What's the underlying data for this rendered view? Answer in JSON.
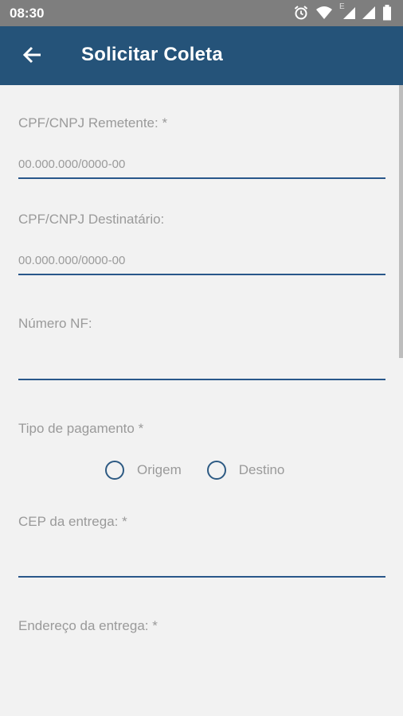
{
  "status_bar": {
    "time": "08:30",
    "icons": [
      "alarm-icon",
      "wifi-icon",
      "signal-e-icon",
      "signal-icon",
      "battery-icon"
    ],
    "network_label": "E"
  },
  "app_bar": {
    "title": "Solicitar Coleta",
    "back_icon": "arrow-left-icon",
    "color": "#255379"
  },
  "form": {
    "cpf_remetente": {
      "label": "CPF/CNPJ Remetente: *",
      "placeholder": "00.000.000/0000-00",
      "value": ""
    },
    "cpf_destinatario": {
      "label": "CPF/CNPJ Destinatário:",
      "placeholder": "00.000.000/0000-00",
      "value": ""
    },
    "numero_nf": {
      "label": "Número NF:",
      "placeholder": "",
      "value": ""
    },
    "tipo_pagamento": {
      "label": "Tipo de pagamento *",
      "options": [
        {
          "label": "Origem",
          "selected": false
        },
        {
          "label": "Destino",
          "selected": false
        }
      ]
    },
    "cep_entrega": {
      "label": "CEP da entrega: *",
      "placeholder": "",
      "value": ""
    },
    "endereco_entrega": {
      "label": "Endereço da entrega: *"
    }
  },
  "accent_color": "#29578a"
}
